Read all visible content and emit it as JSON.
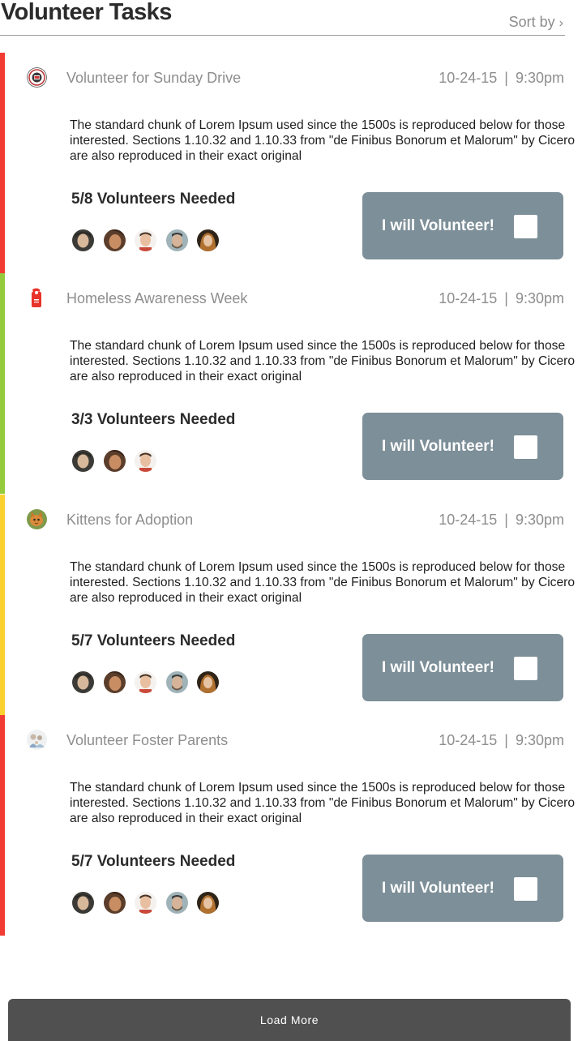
{
  "page": {
    "title": "Volunteer Tasks",
    "sort_label": "Sort by",
    "sort_icon": "chevron-right-icon"
  },
  "load_more_label": "Load More",
  "tasks": [
    {
      "title": "Volunteer for Sunday Drive",
      "date": "10-24-15",
      "time": "9:30pm",
      "description": "The standard chunk of Lorem Ipsum used since the 1500s is reproduced below for those interested. Sections 1.10.32 and 1.10.33 from \"de Finibus Bonorum et Malorum\" by Cicero are also reproduced in their exact original",
      "needed": "5/8 Volunteers Needed",
      "button_label": "I will Volunteer!",
      "accent": "#f23b33",
      "icon": "sunday-drive-logo-icon",
      "avatar_count": 5
    },
    {
      "title": "Homeless Awareness Week",
      "date": "10-24-15",
      "time": "9:30pm",
      "description": "The standard chunk of Lorem Ipsum used since the 1500s is reproduced below for those interested. Sections 1.10.32 and 1.10.33 from \"de Finibus Bonorum et Malorum\" by Cicero are also reproduced in their exact original",
      "needed": "3/3 Volunteers Needed",
      "button_label": "I will Volunteer!",
      "accent": "#93cb3c",
      "icon": "door-hanger-icon",
      "avatar_count": 3
    },
    {
      "title": "Kittens for Adoption",
      "date": "10-24-15",
      "time": "9:30pm",
      "description": "The standard chunk of Lorem Ipsum used since the 1500s is reproduced below for those interested. Sections 1.10.32 and 1.10.33 from \"de Finibus Bonorum et Malorum\" by Cicero are also reproduced in their exact original",
      "needed": "5/7 Volunteers Needed",
      "button_label": "I will Volunteer!",
      "accent": "#fbd12f",
      "icon": "kitten-icon",
      "avatar_count": 5
    },
    {
      "title": "Volunteer Foster Parents",
      "date": "10-24-15",
      "time": "9:30pm",
      "description": "The standard chunk of Lorem Ipsum used since the 1500s is reproduced below for those interested. Sections 1.10.32 and 1.10.33 from \"de Finibus Bonorum et Malorum\" by Cicero are also reproduced in their exact original",
      "needed": "5/7 Volunteers Needed",
      "button_label": "I will Volunteer!",
      "accent": "#f23b33",
      "icon": "foster-family-icon",
      "avatar_count": 5
    }
  ]
}
